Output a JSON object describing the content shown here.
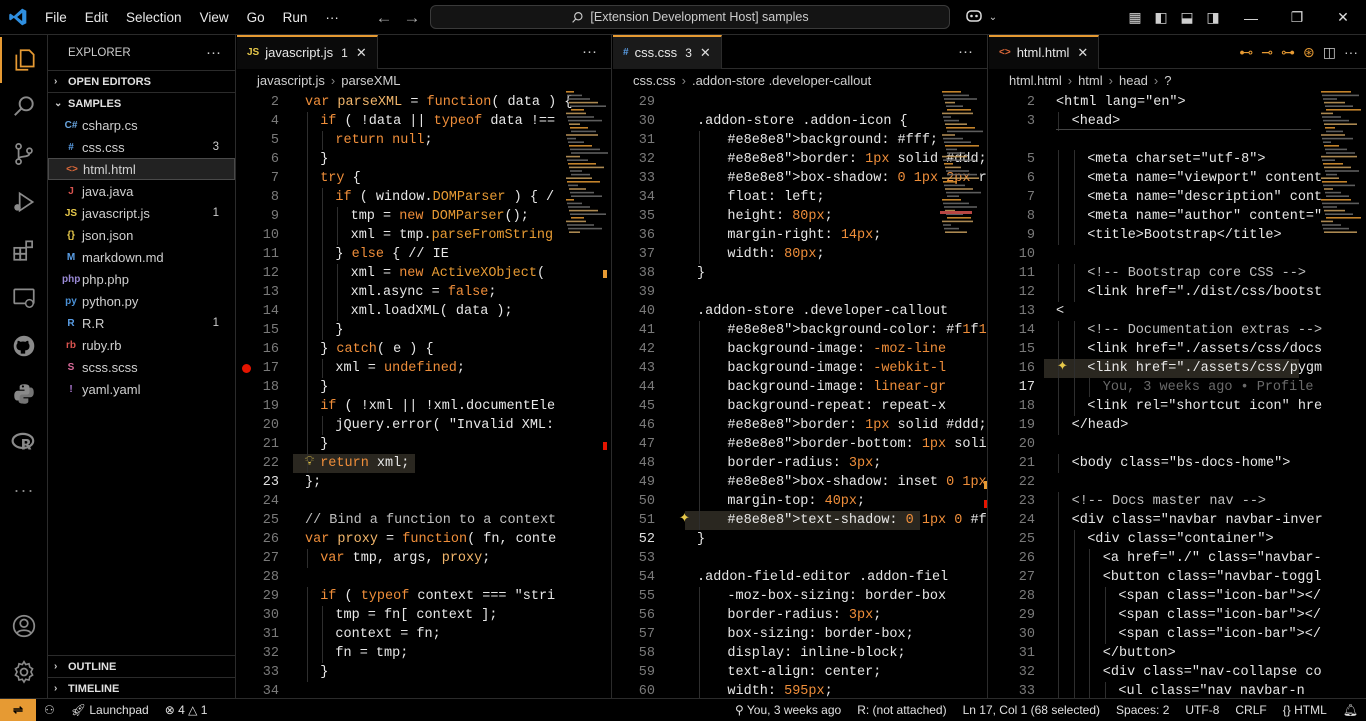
{
  "titlebar": {
    "menu": [
      "File",
      "Edit",
      "Selection",
      "View",
      "Go",
      "Run",
      "···"
    ],
    "search": "[Extension Development Host] samples"
  },
  "sidebar": {
    "title": "EXPLORER",
    "open_editors": "OPEN EDITORS",
    "folder": "SAMPLES",
    "outline": "OUTLINE",
    "timeline": "TIMELINE",
    "files": [
      {
        "name": "csharp.cs",
        "icon": "C#",
        "color": "#6aa6e0",
        "badge": ""
      },
      {
        "name": "css.css",
        "icon": "#",
        "color": "#5a9ee6",
        "badge": "3"
      },
      {
        "name": "html.html",
        "icon": "<>",
        "color": "#e06a3a",
        "badge": "",
        "selected": true
      },
      {
        "name": "java.java",
        "icon": "J",
        "color": "#d9534f",
        "badge": ""
      },
      {
        "name": "javascript.js",
        "icon": "JS",
        "color": "#e6c84a",
        "badge": "1"
      },
      {
        "name": "json.json",
        "icon": "{}",
        "color": "#e6c84a",
        "badge": ""
      },
      {
        "name": "markdown.md",
        "icon": "M",
        "color": "#5a9ee6",
        "badge": ""
      },
      {
        "name": "php.php",
        "icon": "php",
        "color": "#9a8ad6",
        "badge": ""
      },
      {
        "name": "python.py",
        "icon": "py",
        "color": "#4a90d6",
        "badge": ""
      },
      {
        "name": "R.R",
        "icon": "R",
        "color": "#5a9ee6",
        "badge": "1"
      },
      {
        "name": "ruby.rb",
        "icon": "rb",
        "color": "#d9534f",
        "badge": ""
      },
      {
        "name": "scss.scss",
        "icon": "S",
        "color": "#d96a9a",
        "badge": ""
      },
      {
        "name": "yaml.yaml",
        "icon": "!",
        "color": "#b07ad6",
        "badge": ""
      }
    ]
  },
  "panes": [
    {
      "tab": {
        "label": "javascript.js",
        "icon": "JS",
        "icon_color": "#e6c84a",
        "badge": "1"
      },
      "crumbs": [
        "javascript.js",
        "parseXML"
      ],
      "lines": [
        {
          "n": "2",
          "t": "var parseXML = function( data ) {",
          "i": 0
        },
        {
          "n": "4",
          "t": "if ( !data || typeof data !==",
          "i": 1
        },
        {
          "n": "5",
          "t": "return null;",
          "i": 2
        },
        {
          "n": "6",
          "t": "}",
          "i": 1
        },
        {
          "n": "7",
          "t": "try {",
          "i": 1
        },
        {
          "n": "8",
          "t": "if ( window.DOMParser ) { /",
          "i": 2
        },
        {
          "n": "9",
          "t": "tmp = new DOMParser();",
          "i": 3
        },
        {
          "n": "10",
          "t": "xml = tmp.parseFromString",
          "i": 3
        },
        {
          "n": "11",
          "t": "} else { // IE",
          "i": 2
        },
        {
          "n": "12",
          "t": "xml = new ActiveXObject(",
          "i": 3
        },
        {
          "n": "13",
          "t": "xml.async = false;",
          "i": 3
        },
        {
          "n": "14",
          "t": "xml.loadXML( data );",
          "i": 3
        },
        {
          "n": "15",
          "t": "}",
          "i": 2
        },
        {
          "n": "16",
          "t": "} catch( e ) {",
          "i": 1
        },
        {
          "n": "17",
          "t": "xml = undefined;",
          "i": 2
        },
        {
          "n": "18",
          "t": "}",
          "i": 1
        },
        {
          "n": "19",
          "t": "if ( !xml || !xml.documentEle",
          "i": 1
        },
        {
          "n": "20",
          "t": "jQuery.error( \"Invalid XML:",
          "i": 2
        },
        {
          "n": "21",
          "t": "}",
          "i": 1
        },
        {
          "n": "22",
          "t": "return xml;",
          "i": 1
        },
        {
          "n": "23",
          "t": "};",
          "i": 0
        },
        {
          "n": "24",
          "t": "",
          "i": 0
        },
        {
          "n": "25",
          "t": "// Bind a function to a context",
          "i": 0
        },
        {
          "n": "26",
          "t": "var proxy = function( fn, conte",
          "i": 0
        },
        {
          "n": "27",
          "t": "var tmp, args, proxy;",
          "i": 1
        },
        {
          "n": "28",
          "t": "",
          "i": 0
        },
        {
          "n": "29",
          "t": "if ( typeof context === \"stri",
          "i": 1
        },
        {
          "n": "30",
          "t": "tmp = fn[ context ];",
          "i": 2
        },
        {
          "n": "31",
          "t": "context = fn;",
          "i": 2
        },
        {
          "n": "32",
          "t": "fn = tmp;",
          "i": 2
        },
        {
          "n": "33",
          "t": "}",
          "i": 1
        },
        {
          "n": "34",
          "t": "",
          "i": 0
        }
      ]
    },
    {
      "tab": {
        "label": "css.css",
        "icon": "#",
        "icon_color": "#5a9ee6",
        "badge": "3"
      },
      "crumbs": [
        "css.css",
        ".addon-store .developer-callout"
      ],
      "lines": [
        {
          "n": "29",
          "t": "",
          "i": 0
        },
        {
          "n": "30",
          "t": ".addon-store .addon-icon {",
          "i": 0
        },
        {
          "n": "31",
          "t": "background: #fff;",
          "i": 1,
          "sw": "#ffffff"
        },
        {
          "n": "32",
          "t": "border: 1px solid #ddd;",
          "i": 1,
          "sw": "#dddddd"
        },
        {
          "n": "33",
          "t": "box-shadow: 0 1px 2px rgb",
          "i": 1,
          "sw": "#000000"
        },
        {
          "n": "34",
          "t": "float: left;",
          "i": 1
        },
        {
          "n": "35",
          "t": "height: 80px;",
          "i": 1
        },
        {
          "n": "36",
          "t": "margin-right: 14px;",
          "i": 1
        },
        {
          "n": "37",
          "t": "width: 80px;",
          "i": 1
        },
        {
          "n": "38",
          "t": "}",
          "i": 0
        },
        {
          "n": "39",
          "t": "",
          "i": 0
        },
        {
          "n": "40",
          "t": ".addon-store .developer-callout",
          "i": 0
        },
        {
          "n": "41",
          "t": "background-color: #f1f1f1",
          "i": 1,
          "sw": "#f1f1f1"
        },
        {
          "n": "42",
          "t": "background-image: -moz-line",
          "i": 1
        },
        {
          "n": "43",
          "t": "background-image: -webkit-l",
          "i": 1
        },
        {
          "n": "44",
          "t": "background-image: linear-gr",
          "i": 1
        },
        {
          "n": "45",
          "t": "background-repeat: repeat-x",
          "i": 1
        },
        {
          "n": "46",
          "t": "border: 1px solid #ddd;",
          "i": 1,
          "sw": "#dddddd"
        },
        {
          "n": "47",
          "t": "border-bottom: 1px solid ",
          "i": 1,
          "sw": "#cccccc"
        },
        {
          "n": "48",
          "t": "border-radius: 3px;",
          "i": 1
        },
        {
          "n": "49",
          "t": "box-shadow: inset 0 1px 0 ",
          "i": 1,
          "sw": "#ffffff"
        },
        {
          "n": "50",
          "t": "margin-top: 40px;",
          "i": 1
        },
        {
          "n": "51",
          "t": "text-shadow: 0 1px 0 #fff",
          "i": 1,
          "sw": "#ffffff"
        },
        {
          "n": "52",
          "t": "}",
          "i": 0
        },
        {
          "n": "53",
          "t": "",
          "i": 0
        },
        {
          "n": "54",
          "t": ".addon-field-editor .addon-fiel",
          "i": 0
        },
        {
          "n": "55",
          "t": "-moz-box-sizing: border-box",
          "i": 1
        },
        {
          "n": "56",
          "t": "border-radius: 3px;",
          "i": 1
        },
        {
          "n": "57",
          "t": "box-sizing: border-box;",
          "i": 1
        },
        {
          "n": "58",
          "t": "display: inline-block;",
          "i": 1
        },
        {
          "n": "59",
          "t": "text-align: center;",
          "i": 1
        },
        {
          "n": "60",
          "t": "width: 595px;",
          "i": 1
        }
      ]
    },
    {
      "tab": {
        "label": "html.html",
        "icon": "<>",
        "icon_color": "#e06a3a",
        "badge": ""
      },
      "crumbs": [
        "html.html",
        "html",
        "head",
        "?"
      ],
      "lines": [
        {
          "n": "2",
          "t": "<html lang=\"en\">",
          "i": 0
        },
        {
          "n": "3",
          "t": "<head>",
          "i": 1
        },
        {
          "n": "",
          "t": "",
          "i": 0
        },
        {
          "n": "5",
          "t": "<meta charset=\"utf-8\">",
          "i": 2
        },
        {
          "n": "6",
          "t": "<meta name=\"viewport\" content",
          "i": 2
        },
        {
          "n": "7",
          "t": "<meta name=\"description\" cont",
          "i": 2
        },
        {
          "n": "8",
          "t": "<meta name=\"author\" content=\"",
          "i": 2
        },
        {
          "n": "9",
          "t": "<title>Bootstrap</title>",
          "i": 2
        },
        {
          "n": "10",
          "t": "",
          "i": 0
        },
        {
          "n": "11",
          "t": "<!-- Bootstrap core CSS -->",
          "i": 2
        },
        {
          "n": "12",
          "t": "<link href=\"./dist/css/bootst",
          "i": 2
        },
        {
          "n": "13",
          "t": "<",
          "i": 0
        },
        {
          "n": "14",
          "t": "<!-- Documentation extras -->",
          "i": 2
        },
        {
          "n": "15",
          "t": "<link href=\"./assets/css/docs",
          "i": 2
        },
        {
          "n": "16",
          "t": "<link href=\"./assets/css/pygm",
          "i": 2
        },
        {
          "n": "17",
          "t": "You, 3 weeks ago • Profile",
          "i": 3
        },
        {
          "n": "18",
          "t": "<link rel=\"shortcut icon\" hre",
          "i": 2
        },
        {
          "n": "19",
          "t": "</head>",
          "i": 1
        },
        {
          "n": "20",
          "t": "",
          "i": 0
        },
        {
          "n": "21",
          "t": "<body class=\"bs-docs-home\">",
          "i": 1
        },
        {
          "n": "22",
          "t": "",
          "i": 0
        },
        {
          "n": "23",
          "t": "<!-- Docs master nav -->",
          "i": 1
        },
        {
          "n": "24",
          "t": "<div class=\"navbar navbar-inver",
          "i": 1
        },
        {
          "n": "25",
          "t": "<div class=\"container\">",
          "i": 2
        },
        {
          "n": "26",
          "t": "<a href=\"./\" class=\"navbar-",
          "i": 3
        },
        {
          "n": "27",
          "t": "<button class=\"navbar-toggl",
          "i": 3
        },
        {
          "n": "28",
          "t": "<span class=\"icon-bar\"></",
          "i": 4
        },
        {
          "n": "29",
          "t": "<span class=\"icon-bar\"></",
          "i": 4
        },
        {
          "n": "30",
          "t": "<span class=\"icon-bar\"></",
          "i": 4
        },
        {
          "n": "31",
          "t": "</button>",
          "i": 3
        },
        {
          "n": "32",
          "t": "<div class=\"nav-collapse co",
          "i": 3
        },
        {
          "n": "33",
          "t": "<ul class=\"nav navbar-n",
          "i": 4
        },
        {
          "n": "34",
          "t": "<li>",
          "i": 5
        }
      ]
    }
  ],
  "status": {
    "launchpad": "Launchpad",
    "errors": "4",
    "warnings": "1",
    "blame": "You, 3 weeks ago",
    "r": "R: (not attached)",
    "pos": "Ln 17, Col 1 (68 selected)",
    "spaces": "Spaces: 2",
    "enc": "UTF-8",
    "eol": "CRLF",
    "lang": "HTML"
  },
  "colors": {
    "accent": "#e69a33",
    "error": "#e51400"
  }
}
